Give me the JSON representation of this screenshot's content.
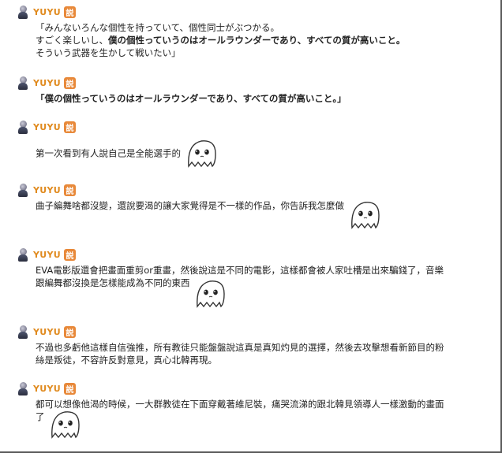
{
  "comments": [
    {
      "user": "YUYU",
      "badge": "説",
      "lines": [
        "「みんないろんな個性を持っていて、個性同士がぶつかる。",
        "すごく楽しいし、僕の個性っていうのはオールラウンダーであり、すべての質が高いこと。",
        "そういう武器を生かして戦いたい」"
      ],
      "bold_part": "僕の個性っていうのはオールラウンダーであり、すべての質が高いこと。"
    },
    {
      "user": "YUYU",
      "badge": "説",
      "lines": [
        "「僕の個性っていうのはオールラウンダーであり、すべての質が高いこと。」"
      ]
    },
    {
      "user": "YUYU",
      "badge": "説",
      "lines": [
        "第一次看到有人說自己是全能選手的"
      ],
      "sticker": "ghost-emoticon-icon"
    },
    {
      "user": "YUYU",
      "badge": "説",
      "lines": [
        "曲子編舞啥都沒變，還說要渴的讓大家覺得是不一樣的作品，你告訴我怎麼做"
      ],
      "sticker": "ghost-emoticon-icon"
    },
    {
      "user": "YUYU",
      "badge": "説",
      "lines": [
        "EVA電影版還會把畫面重剪or重畫，然後說這是不同的電影，這樣都會被人家吐槽是出來騙錢了，音樂",
        "跟編舞都沒換是怎樣能成為不同的東西"
      ],
      "sticker": "ghost-emoticon-icon"
    },
    {
      "user": "YUYU",
      "badge": "説",
      "lines": [
        "不過也多虧他這樣自信強推，所有教徒只能盤盤說這真是真知灼見的選擇，然後去攻擊想看新節目的粉",
        "絲是叛徒，不容許反對意見，真心北韓再現。"
      ]
    },
    {
      "user": "YUYU",
      "badge": "説",
      "lines": [
        "都可以想像他渴的時候，一大群教徒在下面穿戴著維尼裝，痛哭流涕的跟北韓見領導人一樣激動的畫面",
        "了"
      ],
      "sticker": "ghost-emoticon-icon"
    }
  ]
}
